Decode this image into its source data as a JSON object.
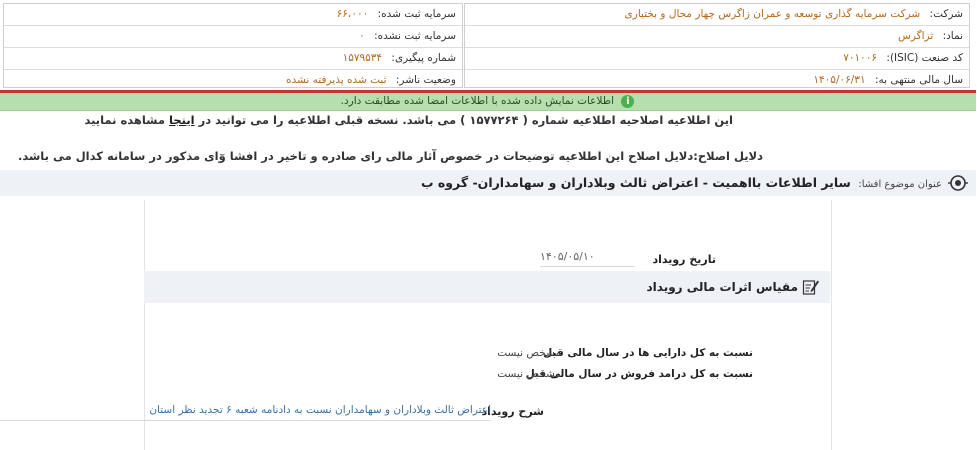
{
  "company_info": {
    "right": [
      {
        "label": "شرکت:",
        "value": "شرکت سرمایه گذاری توسعه و عمران زاگرس چهار محال و بختیاری"
      },
      {
        "label": "نماد:",
        "value": "ثزاگرس"
      },
      {
        "label": "کد صنعت (ISIC):",
        "value": "۷۰۱۰۰۶"
      },
      {
        "label": "سال مالی منتهی به:",
        "value": "۱۴۰۵/۰۶/۳۱"
      }
    ],
    "left": [
      {
        "label": "سرمایه ثبت شده:",
        "value": "۶۶،۰۰۰"
      },
      {
        "label": "سرمایه ثبت نشده:",
        "value": "۰"
      },
      {
        "label": "شماره پیگیری:",
        "value": "۱۵۷۹۵۳۴"
      },
      {
        "label": "وضعیت ناشر:",
        "value": "ثبت شده پذیرفته نشده"
      }
    ]
  },
  "banner": {
    "text": "اطلاعات نمایش داده شده با اطلاعات امضا شده مطابقت دارد.",
    "icon": "info-icon",
    "color": "#b7dfae"
  },
  "notice": {
    "before_link": "این اطلاعیه اصلاحیه اطلاعیه شماره ( ۱۵۷۷۲۶۴ ) می باشد. نسخه قبلی اطلاعیه را می توانید در ",
    "link": "اینجا",
    "after_link": " مشاهده نمایید",
    "reason": "دلایل اصلاح:دلایل اصلاح این اطلاعیه توضیحات در خصوص آثار مالی رای صادره و تاخیر در افشا وٓای مذکور در سامانه کدال می باشد."
  },
  "subject": {
    "label": "عنوان موضوع افشا:",
    "value": "سایر اطلاعات بااهمیت - اعتراض ثالث وبلاداران و سهامداران- گروه ب"
  },
  "event": {
    "date_label": "تاریخ رویداد",
    "date_value": "۱۴۰۵/۰۵/۱۰",
    "section_title": "مقیاس اثرات مالی رویداد",
    "ratios": [
      {
        "label": "نسبت به کل دارایی ها در سال مالی قبل",
        "value": "مشخص نیست"
      },
      {
        "label": "نسبت به کل درامد فروش در سال مالی قبل",
        "value": "مشخص نیست"
      }
    ],
    "description_label": "شرح رویداد",
    "description_value": "اعتراض ثالث وبلاداران و سهامداران نسبت به دادنامه شعبه ۶ تجدید نظر استان"
  },
  "colors": {
    "accent_red": "#c0392b",
    "value_orange": "#b26a1f",
    "panel_bg": "#eef2f7"
  }
}
